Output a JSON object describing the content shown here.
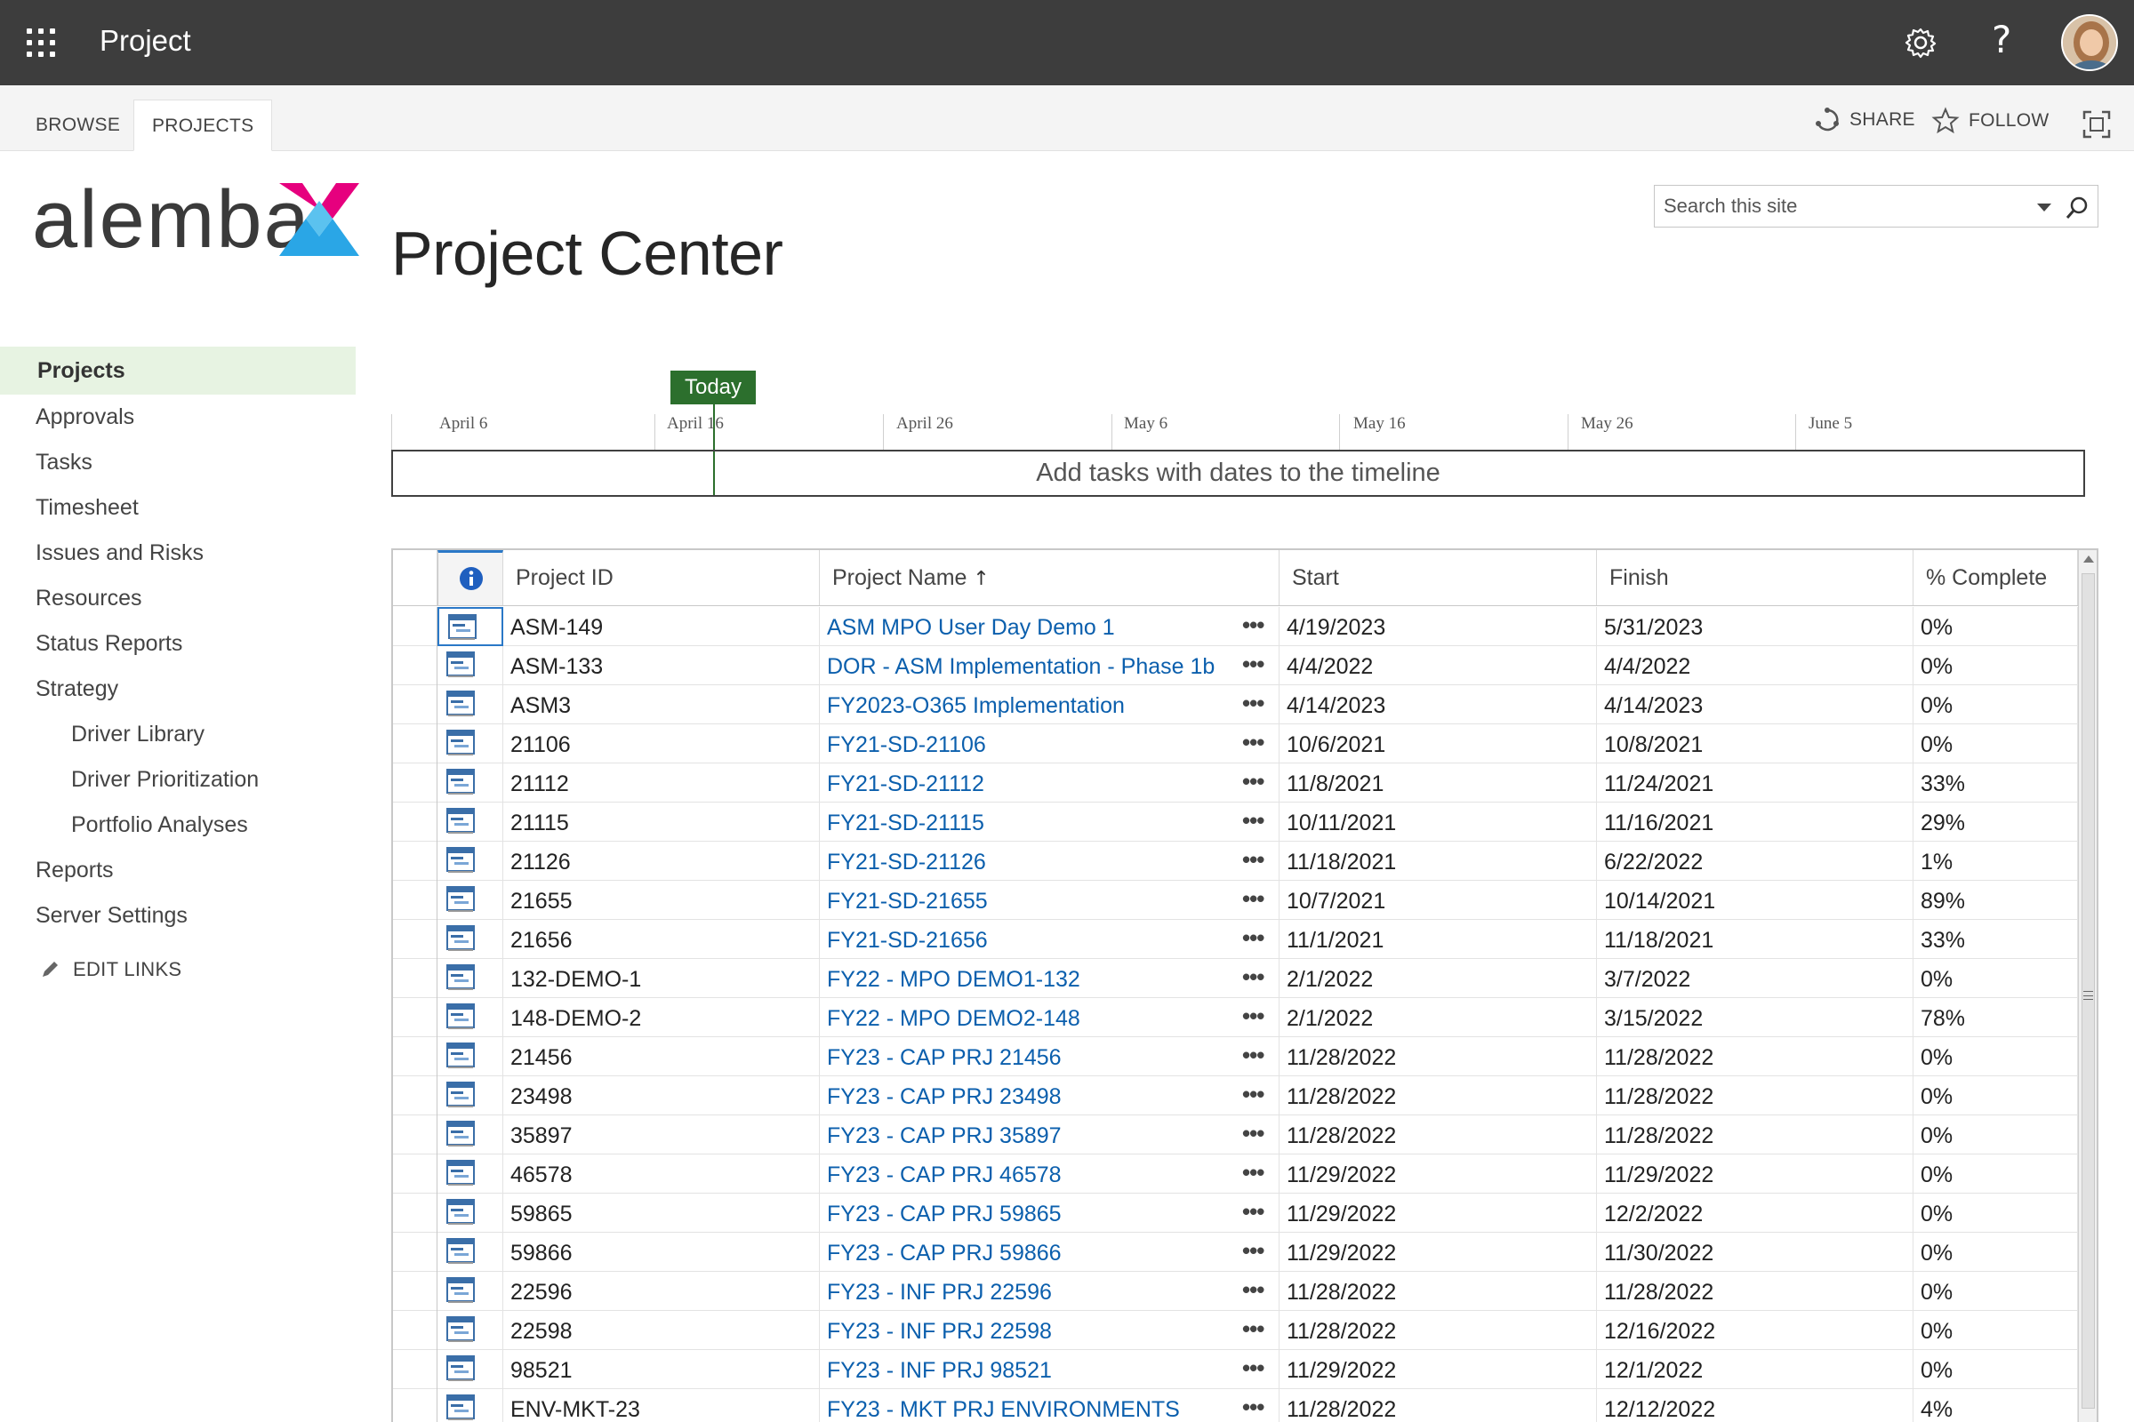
{
  "suitebar": {
    "title": "Project"
  },
  "ribbon": {
    "tabs": [
      "BROWSE",
      "PROJECTS"
    ],
    "share_label": "SHARE",
    "follow_label": "FOLLOW"
  },
  "logo": {
    "text": "alemba"
  },
  "page": {
    "title": "Project Center"
  },
  "search": {
    "placeholder": "Search this site"
  },
  "nav": {
    "items": [
      {
        "label": "Projects",
        "active": true
      },
      {
        "label": "Approvals"
      },
      {
        "label": "Tasks"
      },
      {
        "label": "Timesheet"
      },
      {
        "label": "Issues and Risks"
      },
      {
        "label": "Resources"
      },
      {
        "label": "Status Reports"
      },
      {
        "label": "Strategy"
      },
      {
        "label": "Driver Library",
        "sub": true
      },
      {
        "label": "Driver Prioritization",
        "sub": true
      },
      {
        "label": "Portfolio Analyses",
        "sub": true
      },
      {
        "label": "Reports"
      },
      {
        "label": "Server Settings"
      }
    ],
    "edit_links": "EDIT LINKS"
  },
  "timeline": {
    "today_label": "Today",
    "dates": [
      "April 6",
      "April 16",
      "April 26",
      "May 6",
      "May 16",
      "May 26",
      "June 5"
    ],
    "empty_message": "Add tasks with dates to the timeline"
  },
  "grid": {
    "headers": [
      "Project ID",
      "Project Name",
      "Start",
      "Finish",
      "% Complete"
    ],
    "sort_indicator": "↑",
    "rows": [
      {
        "id": "ASM-149",
        "name": "ASM MPO User Day Demo 1",
        "start": "4/19/2023",
        "finish": "5/31/2023",
        "pct": "0%"
      },
      {
        "id": "ASM-133",
        "name": "DOR - ASM Implementation - Phase 1b",
        "start": "4/4/2022",
        "finish": "4/4/2022",
        "pct": "0%"
      },
      {
        "id": "ASM3",
        "name": "FY2023-O365 Implementation",
        "start": "4/14/2023",
        "finish": "4/14/2023",
        "pct": "0%"
      },
      {
        "id": "21106",
        "name": "FY21-SD-21106",
        "start": "10/6/2021",
        "finish": "10/8/2021",
        "pct": "0%"
      },
      {
        "id": "21112",
        "name": "FY21-SD-21112",
        "start": "11/8/2021",
        "finish": "11/24/2021",
        "pct": "33%"
      },
      {
        "id": "21115",
        "name": "FY21-SD-21115",
        "start": "10/11/2021",
        "finish": "11/16/2021",
        "pct": "29%"
      },
      {
        "id": "21126",
        "name": "FY21-SD-21126",
        "start": "11/18/2021",
        "finish": "6/22/2022",
        "pct": "1%"
      },
      {
        "id": "21655",
        "name": "FY21-SD-21655",
        "start": "10/7/2021",
        "finish": "10/14/2021",
        "pct": "89%"
      },
      {
        "id": "21656",
        "name": "FY21-SD-21656",
        "start": "11/1/2021",
        "finish": "11/18/2021",
        "pct": "33%"
      },
      {
        "id": "132-DEMO-1",
        "name": "FY22 - MPO DEMO1-132",
        "start": "2/1/2022",
        "finish": "3/7/2022",
        "pct": "0%"
      },
      {
        "id": "148-DEMO-2",
        "name": "FY22 - MPO DEMO2-148",
        "start": "2/1/2022",
        "finish": "3/15/2022",
        "pct": "78%"
      },
      {
        "id": "21456",
        "name": "FY23 - CAP PRJ 21456",
        "start": "11/28/2022",
        "finish": "11/28/2022",
        "pct": "0%"
      },
      {
        "id": "23498",
        "name": "FY23 - CAP PRJ 23498",
        "start": "11/28/2022",
        "finish": "11/28/2022",
        "pct": "0%"
      },
      {
        "id": "35897",
        "name": "FY23 - CAP PRJ 35897",
        "start": "11/28/2022",
        "finish": "11/28/2022",
        "pct": "0%"
      },
      {
        "id": "46578",
        "name": "FY23 - CAP PRJ 46578",
        "start": "11/29/2022",
        "finish": "11/29/2022",
        "pct": "0%"
      },
      {
        "id": "59865",
        "name": "FY23 - CAP PRJ 59865",
        "start": "11/29/2022",
        "finish": "12/2/2022",
        "pct": "0%"
      },
      {
        "id": "59866",
        "name": "FY23 - CAP PRJ 59866",
        "start": "11/29/2022",
        "finish": "11/30/2022",
        "pct": "0%"
      },
      {
        "id": "22596",
        "name": "FY23 - INF PRJ 22596",
        "start": "11/28/2022",
        "finish": "11/28/2022",
        "pct": "0%"
      },
      {
        "id": "22598",
        "name": "FY23 - INF PRJ 22598",
        "start": "11/28/2022",
        "finish": "12/16/2022",
        "pct": "0%"
      },
      {
        "id": "98521",
        "name": "FY23 - INF PRJ 98521",
        "start": "11/29/2022",
        "finish": "12/1/2022",
        "pct": "0%"
      },
      {
        "id": "ENV-MKT-23",
        "name": "FY23 - MKT PRJ ENVIRONMENTS",
        "start": "11/28/2022",
        "finish": "12/12/2022",
        "pct": "4%"
      }
    ]
  },
  "colors": {
    "suitebar": "#3d3d3d",
    "accent_green": "#2c6f2d",
    "link_blue": "#0b5fad",
    "nav_active_bg": "#e7f3e2",
    "logo_pink": "#e6007e",
    "logo_blue": "#2aa6e6"
  },
  "icons": [
    "app-launcher-icon",
    "gear-icon",
    "help-icon",
    "share-icon",
    "star-icon",
    "focus-icon",
    "search-icon",
    "pencil-icon",
    "info-icon",
    "project-icon"
  ]
}
